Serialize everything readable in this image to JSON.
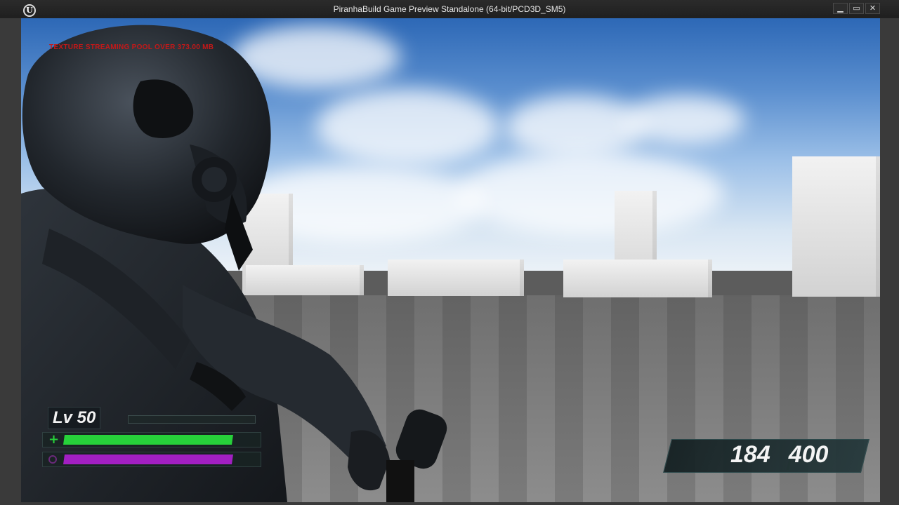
{
  "window": {
    "title": "PiranhaBuild Game Preview Standalone (64-bit/PCD3D_SM5)",
    "logo_glyph": "U",
    "buttons": {
      "minimize": "▁",
      "maximize": "▭",
      "close": "✕"
    }
  },
  "debug": {
    "message": "TEXTURE STREAMING POOL OVER 373.00 MB"
  },
  "hud": {
    "level_label": "Lv 50",
    "xp_fraction": 0.0,
    "health_icon": "+",
    "health_fraction": 1.0,
    "mana_fraction": 1.0,
    "ammo_clip": "184",
    "ammo_reserve": "400",
    "colors": {
      "health": "#27d13a",
      "mana": "#a21fc2",
      "panel": "#1b2a2c"
    }
  }
}
